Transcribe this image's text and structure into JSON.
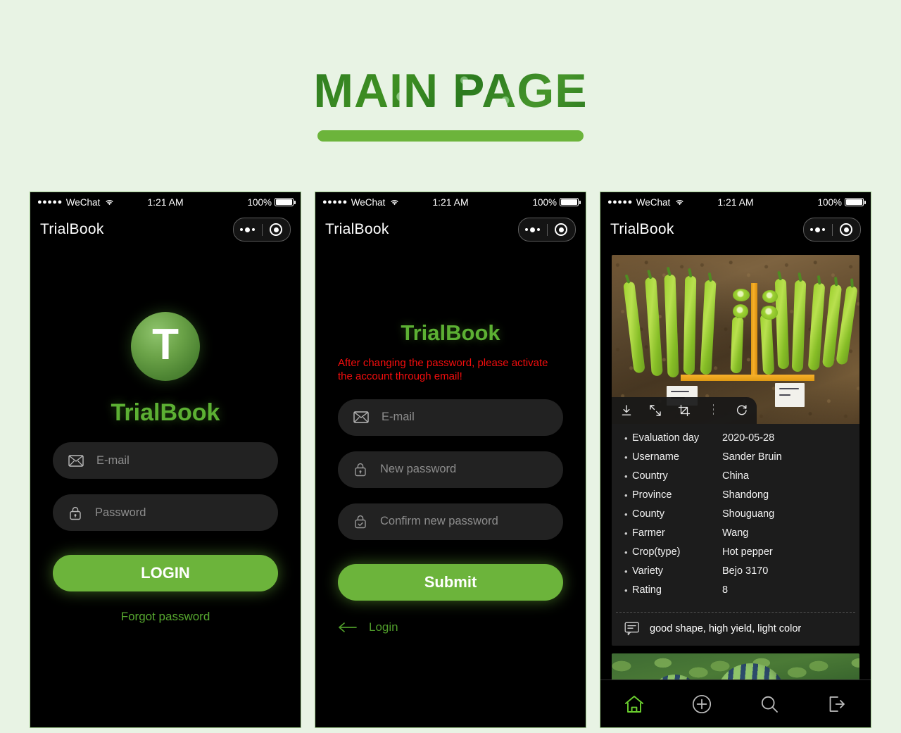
{
  "page": {
    "title": "MAIN PAGE",
    "background_color": "#e8f3e4",
    "accent_green": "#6cb43b",
    "brand_green": "#5cb033",
    "warning_red": "#f40d0d"
  },
  "status_bar": {
    "carrier": "WeChat",
    "signal_dots": "●●●●●",
    "time": "1:21 AM",
    "battery_percent": "100%",
    "wifi_icon": "wifi-icon",
    "battery_icon": "battery-icon"
  },
  "app_bar": {
    "brand": "TrialBook",
    "capsule": {
      "more_icon": "more-dots-icon",
      "target_icon": "target-icon"
    }
  },
  "screens": [
    {
      "id": "login",
      "logo_letter": "T",
      "brand": "TrialBook",
      "fields": [
        {
          "name": "email",
          "icon": "envelope-icon",
          "placeholder": "E-mail",
          "value": ""
        },
        {
          "name": "password",
          "icon": "lock-icon",
          "placeholder": "Password",
          "value": ""
        }
      ],
      "primary_button": "LOGIN",
      "link": "Forgot password"
    },
    {
      "id": "reset-password",
      "brand": "TrialBook",
      "warning": "After changing the password, please activate the account through email!",
      "fields": [
        {
          "name": "email",
          "icon": "envelope-icon",
          "placeholder": "E-mail",
          "value": ""
        },
        {
          "name": "new-password",
          "icon": "lock-icon",
          "placeholder": "New password",
          "value": ""
        },
        {
          "name": "confirm-new-password",
          "icon": "lock-check-icon",
          "placeholder": "Confirm new password",
          "value": ""
        }
      ],
      "primary_button": "Submit",
      "back_link": "Login",
      "back_icon": "arrow-left-icon"
    },
    {
      "id": "feed",
      "image_toolbar": [
        {
          "name": "download",
          "icon": "download-icon"
        },
        {
          "name": "fullscreen",
          "icon": "expand-icon"
        },
        {
          "name": "crop",
          "icon": "crop-icon"
        },
        {
          "name": "divider",
          "icon": "vertical-dots-divider-icon"
        },
        {
          "name": "rotate",
          "icon": "rotate-icon"
        }
      ],
      "details": [
        {
          "label": "Evaluation day",
          "value": "2020-05-28"
        },
        {
          "label": "Username",
          "value": "Sander Bruin"
        },
        {
          "label": "Country",
          "value": "China"
        },
        {
          "label": "Province",
          "value": "Shandong"
        },
        {
          "label": "County",
          "value": "Shouguang"
        },
        {
          "label": "Farmer",
          "value": "Wang"
        },
        {
          "label": "Crop(type)",
          "value": "Hot pepper"
        },
        {
          "label": "Variety",
          "value": "Bejo 3170"
        },
        {
          "label": "Rating",
          "value": "8"
        }
      ],
      "comment": {
        "icon": "comment-icon",
        "text": "good shape, high yield, light color"
      },
      "tabbar": [
        {
          "name": "home",
          "icon": "home-icon",
          "active": true
        },
        {
          "name": "add",
          "icon": "plus-circle-icon",
          "active": false
        },
        {
          "name": "search",
          "icon": "search-icon",
          "active": false
        },
        {
          "name": "logout",
          "icon": "logout-icon",
          "active": false
        }
      ]
    }
  ]
}
